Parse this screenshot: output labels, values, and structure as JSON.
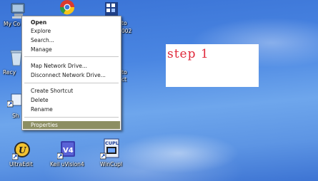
{
  "desktop": {
    "icons": {
      "my_computer": {
        "label": "My Co"
      },
      "recycle": {
        "label": "Recy"
      },
      "shortcut_sh": {
        "label": "Sh"
      },
      "partial_a": {
        "label": "to"
      },
      "partial_a2": {
        "label": "002"
      },
      "partial_b": {
        "label": "to"
      },
      "partial_b2": {
        "label": "ct"
      },
      "ultraedit": {
        "label": "UltraEdit"
      },
      "keil": {
        "label": "Keil uVision4"
      },
      "wincupl": {
        "label": "WinCupl"
      }
    },
    "glyph_text": {
      "uvision": "V4",
      "cupl": "CUPL"
    }
  },
  "context_menu": {
    "items": [
      {
        "label": "Open",
        "bold": true
      },
      {
        "label": "Explore"
      },
      {
        "label": "Search..."
      },
      {
        "label": "Manage"
      },
      {
        "label": "Map Network Drive..."
      },
      {
        "label": "Disconnect Network Drive..."
      },
      {
        "label": "Create Shortcut"
      },
      {
        "label": "Delete"
      },
      {
        "label": "Rename"
      },
      {
        "label": "Properties",
        "highlighted": true
      }
    ],
    "highlight_color": "#8c8e62"
  },
  "annotation": {
    "text": "step 1",
    "color": "#e0283a"
  }
}
